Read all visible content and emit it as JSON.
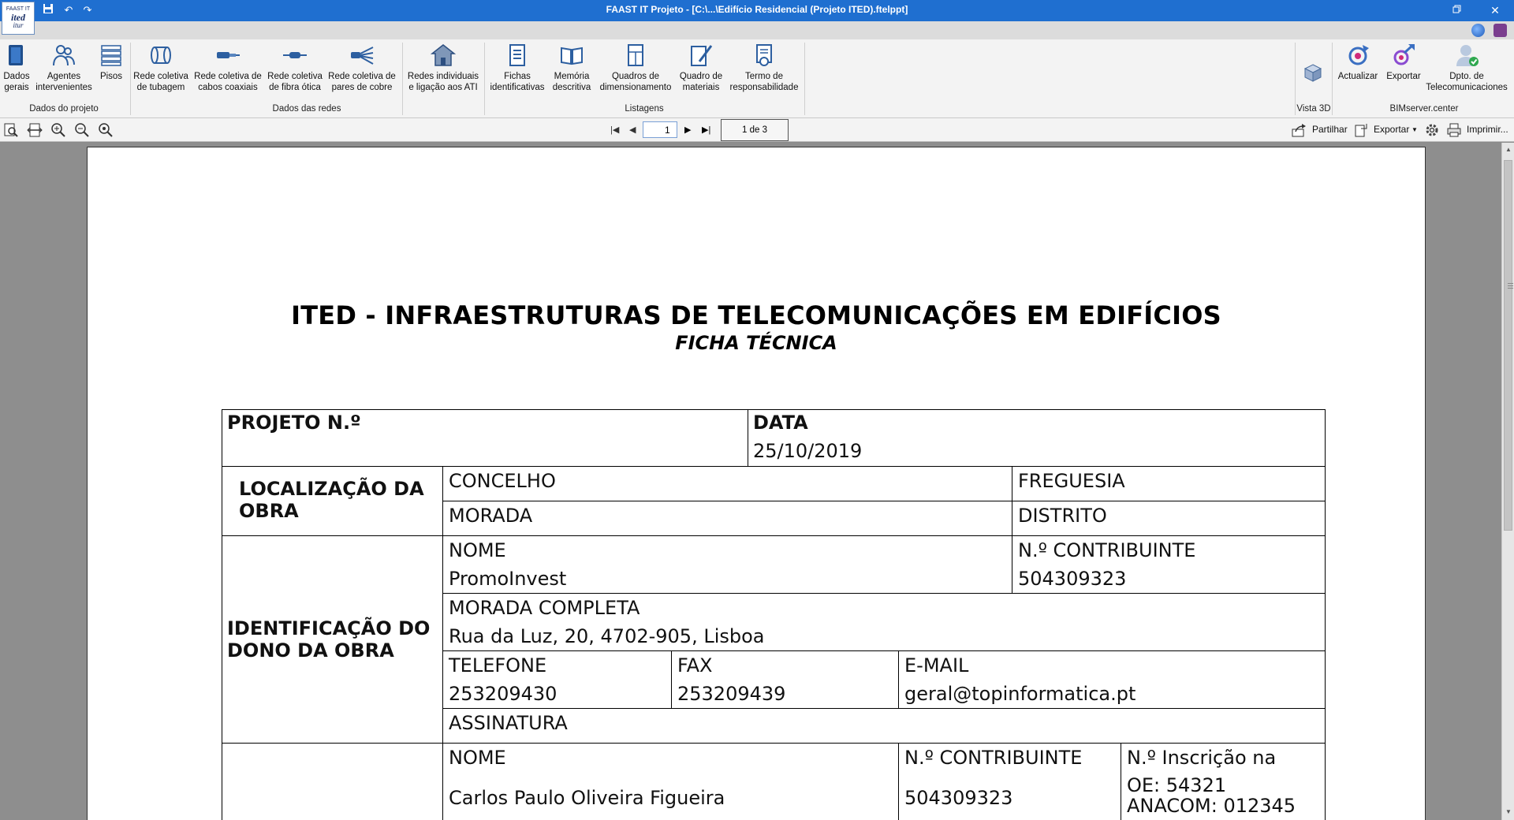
{
  "app": {
    "title": "FAAST IT Projeto - [C:\\...\\Edifício Residencial (Projeto ITED).ftelppt]",
    "logo_lines": [
      "FAAST IT",
      "ited",
      "itur"
    ]
  },
  "ribbon": {
    "groups": {
      "project": "Dados do projeto",
      "networks": "Dados das redes",
      "listings": "Listagens",
      "view3d": "Vista 3D",
      "bimserver": "BIMserver.center"
    },
    "buttons": {
      "general_data": [
        "Dados",
        "gerais"
      ],
      "agents": [
        "Agentes",
        "intervenientes"
      ],
      "floors": [
        "Pisos"
      ],
      "tubing": [
        "Rede coletiva",
        "de tubagem"
      ],
      "coax": [
        "Rede coletiva de",
        "cabos coaxiais"
      ],
      "fiber": [
        "Rede coletiva",
        "de fibra ótica"
      ],
      "copper": [
        "Rede coletiva de",
        "pares de cobre"
      ],
      "individual": [
        "Redes individuais",
        "e ligação aos ATI"
      ],
      "id_sheets": [
        "Fichas",
        "identificativas"
      ],
      "memory": [
        "Memória",
        "descritiva"
      ],
      "sizing": [
        "Quadros de",
        "dimensionamento"
      ],
      "materials": [
        "Quadro de",
        "materiais"
      ],
      "liability": [
        "Termo de",
        "responsabilidade"
      ],
      "update": [
        "Actualizar"
      ],
      "export": [
        "Exportar"
      ],
      "telecom": [
        "Dpto. de",
        "Telecomunicaciones"
      ]
    }
  },
  "toolbar": {
    "current_page": "1",
    "page_info": "1 de 3",
    "share": "Partilhar",
    "export": "Exportar",
    "print": "Imprimir..."
  },
  "document": {
    "title": "ITED - INFRAESTRUTURAS DE TELECOMUNICAÇÕES EM EDIFÍCIOS",
    "subtitle": "FICHA TÉCNICA",
    "project_no_label": "PROJETO N.º",
    "date_label": "DATA",
    "date_value": "25/10/2019",
    "location_label": [
      "LOCALIZAÇÃO DA",
      "OBRA"
    ],
    "concelho_label": "CONCELHO",
    "freguesia_label": "FREGUESIA",
    "morada_label": "MORADA",
    "distrito_label": "DISTRITO",
    "owner_label": [
      "IDENTIFICAÇÃO DO",
      "DONO DA OBRA"
    ],
    "owner_name_label": "NOME",
    "owner_name": "PromoInvest",
    "owner_nif_label": "N.º CONTRIBUINTE",
    "owner_nif": "504309323",
    "owner_address_label": "MORADA COMPLETA",
    "owner_address": "Rua da Luz, 20, 4702-905, Lisboa",
    "phone_label": "TELEFONE",
    "phone": "253209430",
    "fax_label": "FAX",
    "fax": "253209439",
    "email_label": "E-MAIL",
    "email": "geral@topinformatica.pt",
    "signature_label": "ASSINATURA",
    "designer_name_label": "NOME",
    "designer_name": "Carlos Paulo Oliveira Figueira",
    "designer_nif_label": "N.º CONTRIBUINTE",
    "designer_nif": "504309323",
    "registration_label": "N.º Inscrição na",
    "registration_oe": "OE: 54321",
    "registration_anacom": "ANACOM: 012345"
  }
}
